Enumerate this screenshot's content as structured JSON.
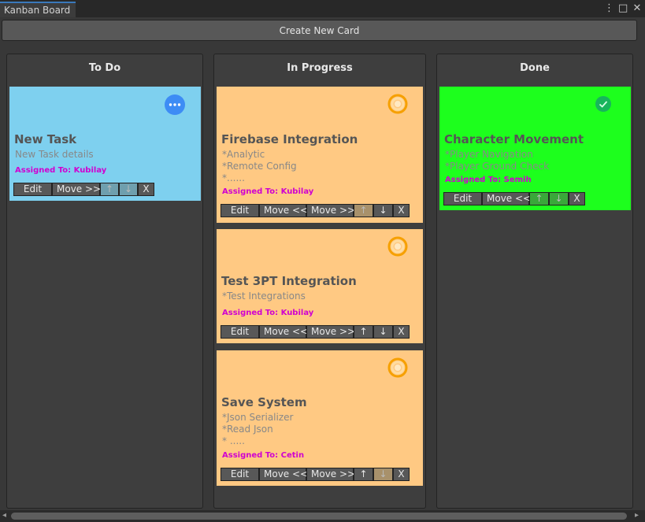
{
  "window": {
    "tab_title": "Kanban Board",
    "icons": [
      "menu-kebab-icon",
      "maximize-icon",
      "close-icon"
    ]
  },
  "toolbar": {
    "create_label": "Create New Card"
  },
  "colors": {
    "todo_card": "#7ed0ef",
    "progress_card": "#ffc983",
    "done_card": "#1dff1d",
    "assigned": "#d000d0"
  },
  "columns": {
    "todo": {
      "title": "To Do",
      "cards": [
        {
          "title": "New Task",
          "details": [
            "New Task details"
          ],
          "assigned": "Assigned To: Kubilay",
          "buttons": [
            "Edit",
            "Move >>",
            "↑",
            "↓",
            "X"
          ]
        }
      ]
    },
    "progress": {
      "title": "In Progress",
      "cards": [
        {
          "title": "Firebase Integration",
          "details": [
            "*Analytic",
            "*Remote Config",
            "*......"
          ],
          "assigned": "Assigned To: Kubilay",
          "buttons": [
            "Edit",
            "Move <<",
            "Move >>",
            "↑",
            "↓",
            "X"
          ]
        },
        {
          "title": "Test 3PT Integration",
          "details": [
            "*Test Integrations"
          ],
          "assigned": "Assigned To: Kubilay",
          "buttons": [
            "Edit",
            "Move <<",
            "Move >>",
            "↑",
            "↓",
            "X"
          ]
        },
        {
          "title": "Save System",
          "details": [
            "*Json Serializer",
            "*Read Json",
            "* ....."
          ],
          "assigned": "Assigned To: Cetin",
          "buttons": [
            "Edit",
            "Move <<",
            "Move >>",
            "↑",
            "↓",
            "X"
          ]
        }
      ]
    },
    "done": {
      "title": "Done",
      "cards": [
        {
          "title": "Character Movement",
          "details": [
            "*Player Navigation",
            "*Player Ground Check"
          ],
          "assigned": "Assigned To: Semih",
          "buttons": [
            "Edit",
            "Move <<",
            "↑",
            "↓",
            "X"
          ]
        }
      ]
    }
  },
  "scrollbar": {
    "left_arrow": "◂",
    "right_arrow": "▸"
  }
}
